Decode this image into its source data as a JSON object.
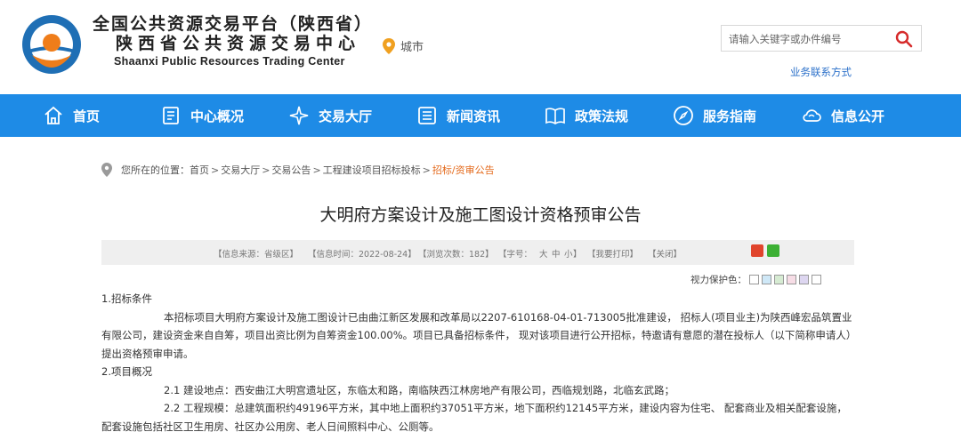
{
  "header": {
    "title_line1": "全国公共资源交易平台（陕西省）",
    "title_line2": "陕西省公共资源交易中心",
    "title_en": "Shaanxi Public Resources Trading Center",
    "city_label": "城市",
    "search_placeholder": "请输入关键字或办件编号",
    "biz_contact": "业务联系方式",
    "logo_colors": {
      "blue": "#1f6fb5",
      "orange": "#ef7d1a"
    }
  },
  "nav": {
    "background": "#1e8be6",
    "items": [
      {
        "label": "首页",
        "icon": "home-icon"
      },
      {
        "label": "中心概况",
        "icon": "document-icon"
      },
      {
        "label": "交易大厅",
        "icon": "sparkle-icon"
      },
      {
        "label": "新闻资讯",
        "icon": "news-icon"
      },
      {
        "label": "政策法规",
        "icon": "book-icon"
      },
      {
        "label": "服务指南",
        "icon": "compass-icon"
      },
      {
        "label": "信息公开",
        "icon": "cloud-icon"
      }
    ]
  },
  "breadcrumb": {
    "prefix": "您所在的位置：",
    "items": [
      "首页",
      "交易大厅",
      "交易公告",
      "工程建设项目招标投标",
      "招标/资审公告"
    ],
    "sep": ">"
  },
  "article": {
    "title": "大明府方案设计及施工图设计资格预审公告",
    "info": {
      "source": "【信息来源：省级区】",
      "time": "【信息时间：2022-08-24】",
      "views": "【浏览次数：182】",
      "fontsize": "【字号：",
      "font_big": "大",
      "font_mid": "中",
      "font_small": "小",
      "fontsize_end": "】",
      "print": "【我要打印】",
      "close": "【关闭】"
    },
    "eyecare_label": "视力保护色：",
    "eyecare_colors": [
      "#ffffff",
      "#cfe8f7",
      "#d6ebd2",
      "#f7dde6",
      "#ddd6f0",
      "#ffffff"
    ],
    "sections": {
      "s1_head": "1.招标条件",
      "s1_body": "本招标项目大明府方案设计及施工图设计已由曲江新区发展和改革局以2207-610168-04-01-713005批准建设， 招标人(项目业主)为陕西峰宏品筑置业有限公司，建设资金来自自筹，项目出资比例为自筹资金100.00%。项目已具备招标条件， 现对该项目进行公开招标，特邀请有意愿的潜在投标人（以下简称申请人）提出资格预审申请。",
      "s2_head": "2.项目概况",
      "s2_1": "2.1 建设地点：西安曲江大明宫遗址区，东临太和路，南临陕西江林房地产有限公司，西临规划路，北临玄武路；",
      "s2_2": "2.2 工程规模：总建筑面积约49196平方米，其中地上面积约37051平方米，地下面积约12145平方米，建设内容为住宅、 配套商业及相关配套设施，配套设施包括社区卫生用房、社区办公用房、老人日间照料中心、公厕等。"
    }
  }
}
